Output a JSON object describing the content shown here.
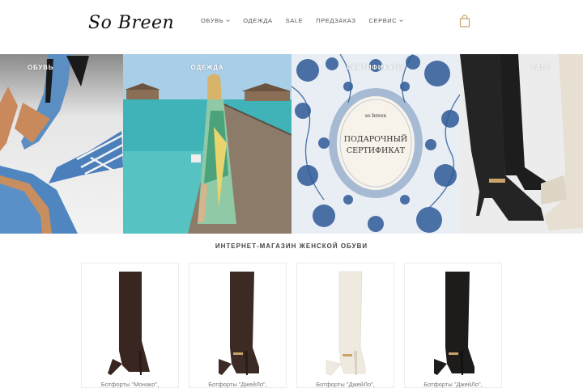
{
  "header": {
    "logo_text": "So Breen",
    "nav": [
      {
        "label": "ОБУВЬ",
        "has_dropdown": true
      },
      {
        "label": "ОДЕЖДА",
        "has_dropdown": false
      },
      {
        "label": "SALE",
        "has_dropdown": false
      },
      {
        "label": "ПРЕДЗАКАЗ",
        "has_dropdown": false
      },
      {
        "label": "СЕРВИС",
        "has_dropdown": true
      }
    ],
    "cart_icon": "shopping-bag-icon"
  },
  "banners": [
    {
      "label": "ОБУВЬ"
    },
    {
      "label": "ОДЕЖДА"
    },
    {
      "label": "СЕРТИФИКАТЫ",
      "card_brand": "so breen",
      "card_text_line1": "ПОДАРОЧНЫЙ",
      "card_text_line2": "СЕРТИФИКАТ"
    },
    {
      "label": "SALE"
    }
  ],
  "section_title": "ИНТЕРНЕТ-МАГАЗИН ЖЕНСКОЙ ОБУВИ",
  "products": [
    {
      "name": "Ботфорты \"Монако\",",
      "color": "#3a2620"
    },
    {
      "name": "Ботфорты \"ДжейЛо\",",
      "color": "#3c2a24"
    },
    {
      "name": "Ботфорты \"ДжейЛо\",",
      "color": "#efeae0"
    },
    {
      "name": "Ботфорты \"ДжейЛо\",",
      "color": "#1e1c1b"
    }
  ],
  "colors": {
    "accent": "#c9a36a",
    "nav_text": "#555555"
  }
}
